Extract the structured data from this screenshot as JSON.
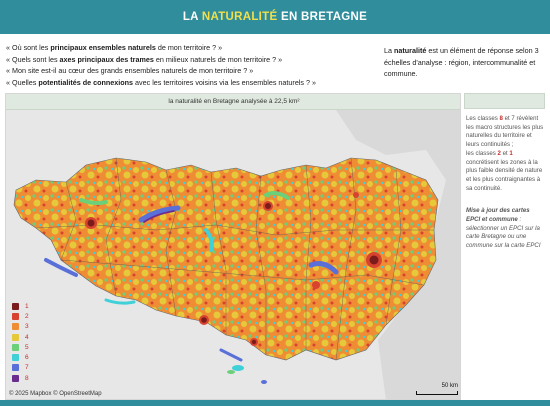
{
  "header": {
    "title_prefix": "LA ",
    "title_highlight": "NATURALITÉ",
    "title_suffix": " EN BRETAGNE",
    "bg_color": "#2f8d9c",
    "highlight_color": "#f1e04b"
  },
  "questions": [
    {
      "pre": "« Où sont les ",
      "bold": "principaux ensembles naturels",
      "post": " de mon territoire ? »"
    },
    {
      "pre": "« Quels sont les ",
      "bold": "axes principaux des trames",
      "post": " en milieux naturels de mon territoire ? »"
    },
    {
      "pre": "« Mon site est-il au cœur des grands ensembles naturels de mon territoire ? »",
      "bold": "",
      "post": ""
    },
    {
      "pre": "« Quelles ",
      "bold": "potentialités de connexions",
      "post": " avec les territoires voisins via les ensembles naturels ? »"
    }
  ],
  "intro": {
    "pre": "La ",
    "bold": "naturalité",
    "post": " est un élément de réponse selon 3 échelles d'analyse : région, intercommunalité et commune."
  },
  "map": {
    "title": "la naturalité en Bretagne analysée à 22,5 km²",
    "attribution": "© 2025 Mapbox  © OpenStreetMap",
    "scale_label": "50 km",
    "legend": [
      {
        "label": "1",
        "color": "#7a1c1c"
      },
      {
        "label": "2",
        "color": "#d8432f"
      },
      {
        "label": "3",
        "color": "#ef8d34"
      },
      {
        "label": "4",
        "color": "#e6c93a"
      },
      {
        "label": "5",
        "color": "#6ccf7a"
      },
      {
        "label": "6",
        "color": "#3fd0d8"
      },
      {
        "label": "7",
        "color": "#5a6fd8"
      },
      {
        "label": "8",
        "color": "#6a2d8e"
      }
    ]
  },
  "side": {
    "text_1": "Les classes ",
    "cls_8": "8",
    "text_2": " et 7 révèlent les macro structures les plus naturelles du territoire et leurs continuités ;",
    "text_3": "les classes ",
    "cls_2": "2",
    "text_4": " et ",
    "cls_1": "1",
    "text_5": " concrétisent les zones à la plus faible densité de nature et les plus contraignantes à sa continuité.",
    "note_bold": "Mise à jour des cartes EPCI et commune",
    "note_rest": " : sélectionner un EPCI sur la carte Bretagne ou une commune sur la carte EPCI"
  }
}
